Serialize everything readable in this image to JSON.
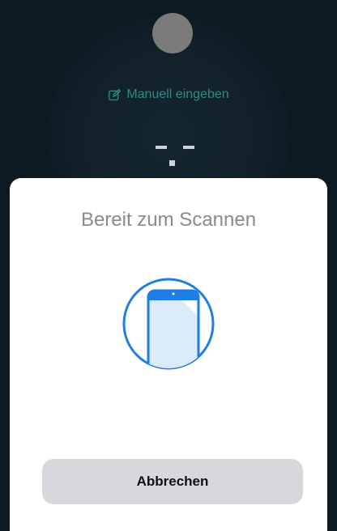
{
  "background": {
    "manual_entry_label": "Manuell eingeben",
    "manual_entry_icon": "edit-icon",
    "accent_color": "#2e8a83"
  },
  "sheet": {
    "title": "Bereit zum Scannen",
    "illustration_icon": "phone-nfc-scan-icon",
    "illustration_color": "#1f7de6",
    "cancel_label": "Abbrechen"
  }
}
